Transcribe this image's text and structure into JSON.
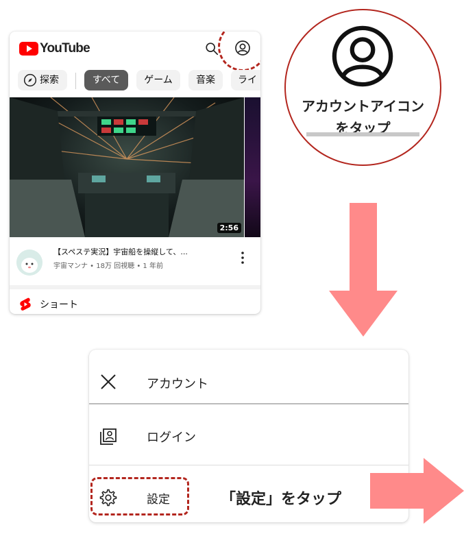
{
  "youtube": {
    "logo_text": "YouTube",
    "chips": {
      "explore": "探索",
      "all": "すべて",
      "game": "ゲーム",
      "music": "音楽",
      "live": "ライ"
    },
    "video": {
      "duration": "2:56",
      "title": "【スペステ実況】宇宙船を操縦して、...",
      "meta": "宇宙マンナ • 18万 回視聴 • 1 年前"
    },
    "shorts_label": "ショート"
  },
  "callout": {
    "line1": "アカウントアイコン",
    "line2": "をタップ"
  },
  "menu": {
    "account": "アカウント",
    "login": "ログイン",
    "settings": "設定"
  },
  "settings_hint": "「設定」をタップ",
  "colors": {
    "highlight": "#b3261e",
    "arrow": "#ff8a8a",
    "youtube_red": "#ff0000"
  }
}
